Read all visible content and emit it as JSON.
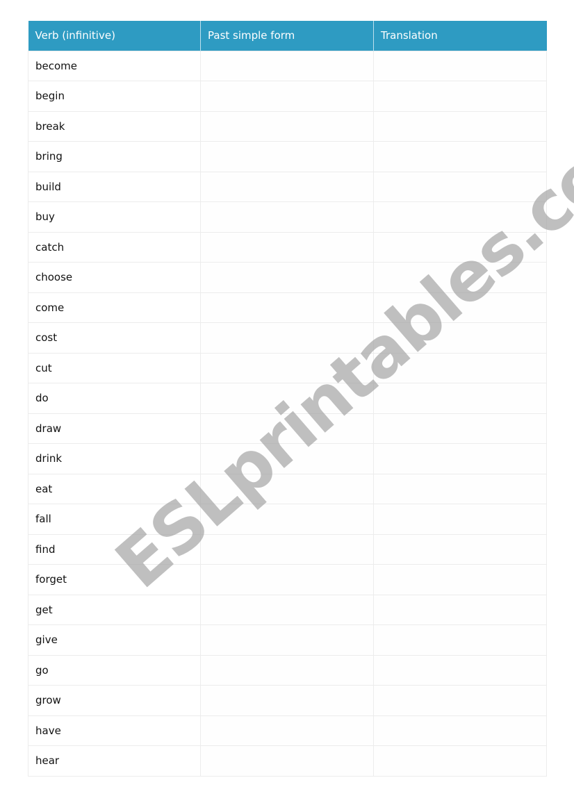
{
  "table": {
    "headers": [
      "Verb (infinitive)",
      "Past simple form",
      "Translation"
    ],
    "rows": [
      {
        "verb": "become",
        "past": "",
        "translation": ""
      },
      {
        "verb": "begin",
        "past": "",
        "translation": ""
      },
      {
        "verb": "break",
        "past": "",
        "translation": ""
      },
      {
        "verb": "bring",
        "past": "",
        "translation": ""
      },
      {
        "verb": "build",
        "past": "",
        "translation": ""
      },
      {
        "verb": "buy",
        "past": "",
        "translation": ""
      },
      {
        "verb": "catch",
        "past": "",
        "translation": ""
      },
      {
        "verb": "choose",
        "past": "",
        "translation": ""
      },
      {
        "verb": "come",
        "past": "",
        "translation": ""
      },
      {
        "verb": "cost",
        "past": "",
        "translation": ""
      },
      {
        "verb": "cut",
        "past": "",
        "translation": ""
      },
      {
        "verb": "do",
        "past": "",
        "translation": ""
      },
      {
        "verb": "draw",
        "past": "",
        "translation": ""
      },
      {
        "verb": "drink",
        "past": "",
        "translation": ""
      },
      {
        "verb": "eat",
        "past": "",
        "translation": ""
      },
      {
        "verb": "fall",
        "past": "",
        "translation": ""
      },
      {
        "verb": "find",
        "past": "",
        "translation": ""
      },
      {
        "verb": "forget",
        "past": "",
        "translation": ""
      },
      {
        "verb": "get",
        "past": "",
        "translation": ""
      },
      {
        "verb": "give",
        "past": "",
        "translation": ""
      },
      {
        "verb": "go",
        "past": "",
        "translation": ""
      },
      {
        "verb": "grow",
        "past": "",
        "translation": ""
      },
      {
        "verb": "have",
        "past": "",
        "translation": ""
      },
      {
        "verb": "hear",
        "past": "",
        "translation": ""
      }
    ]
  },
  "watermark": "ESLprintables.com",
  "colors": {
    "header_bg": "#2e9bc2",
    "header_text": "#ffffff",
    "watermark": "#a0a0a0"
  }
}
